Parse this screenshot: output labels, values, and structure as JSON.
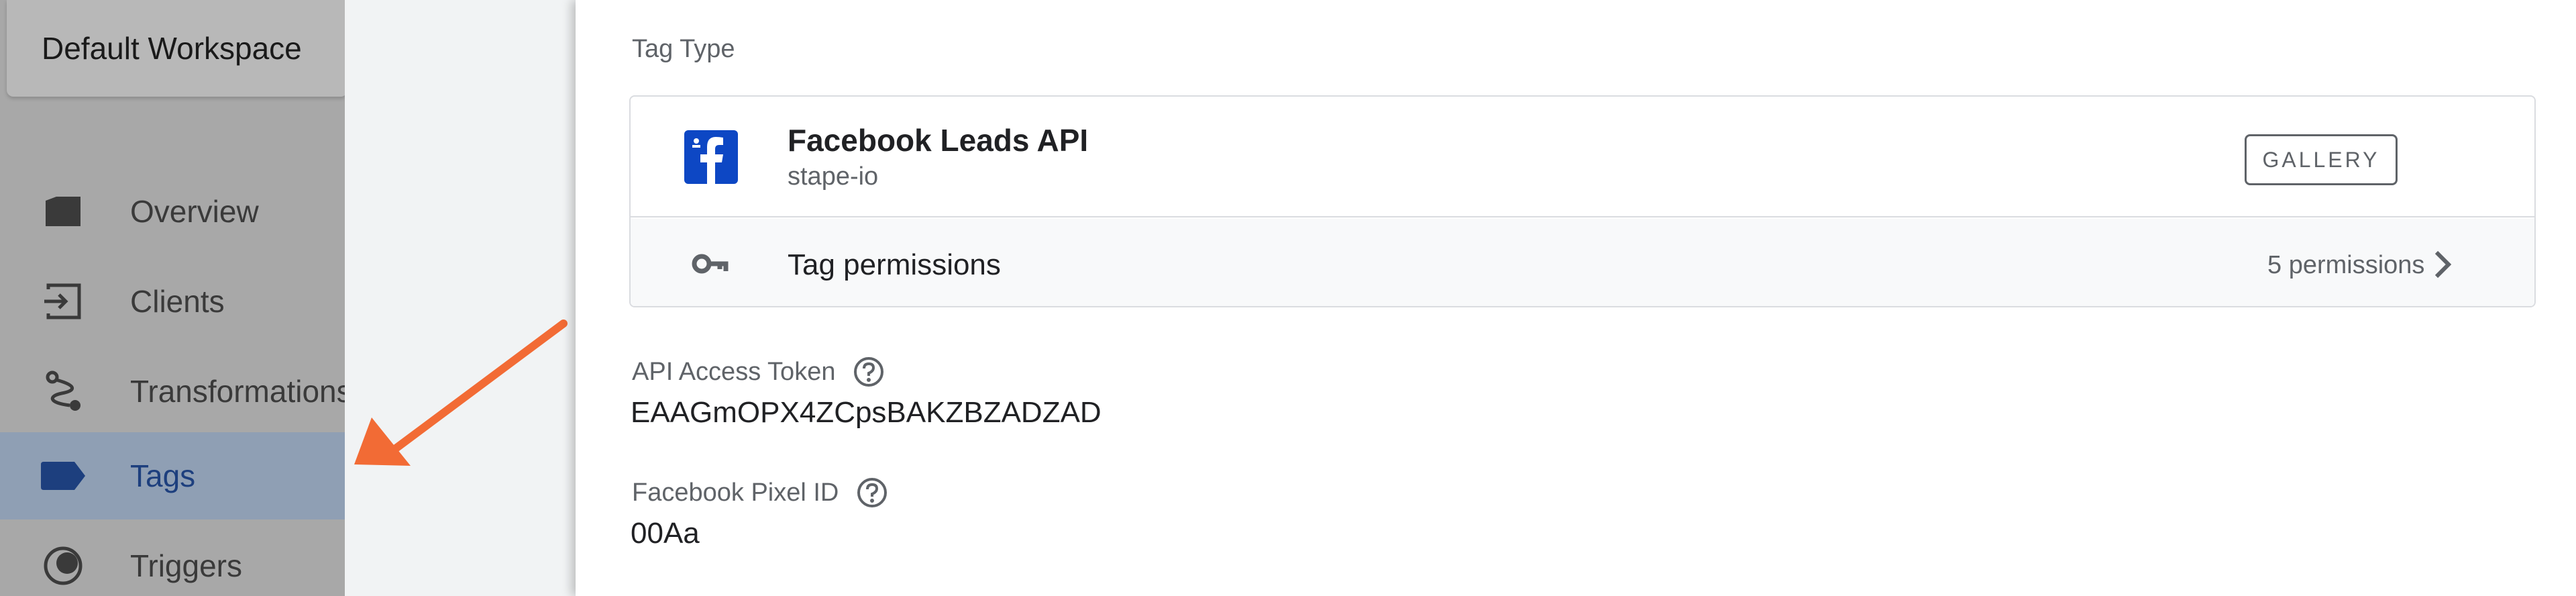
{
  "sidebar": {
    "workspace_label": "Default Workspace",
    "items": [
      {
        "label": "Overview",
        "icon": "folder-icon"
      },
      {
        "label": "Clients",
        "icon": "login-icon"
      },
      {
        "label": "Transformations",
        "icon": "route-icon"
      },
      {
        "label": "Tags",
        "icon": "tag-icon",
        "active": true
      },
      {
        "label": "Triggers",
        "icon": "trigger-icon"
      }
    ]
  },
  "panel": {
    "tag_type_label": "Tag Type",
    "tag": {
      "name": "Facebook Leads API",
      "publisher": "stape-io",
      "gallery_label": "GALLERY",
      "permissions_label": "Tag permissions",
      "permissions_count": "5 permissions"
    },
    "fields": [
      {
        "label": "API Access Token",
        "value": "EAAGmOPX4ZCpsBAKZBZADZAD"
      },
      {
        "label": "Facebook Pixel ID",
        "value": "00Aa"
      }
    ]
  },
  "colors": {
    "active_nav": "#1d3f7e",
    "facebook_blue": "#0d47c4",
    "annotation_arrow": "#f26b35"
  }
}
